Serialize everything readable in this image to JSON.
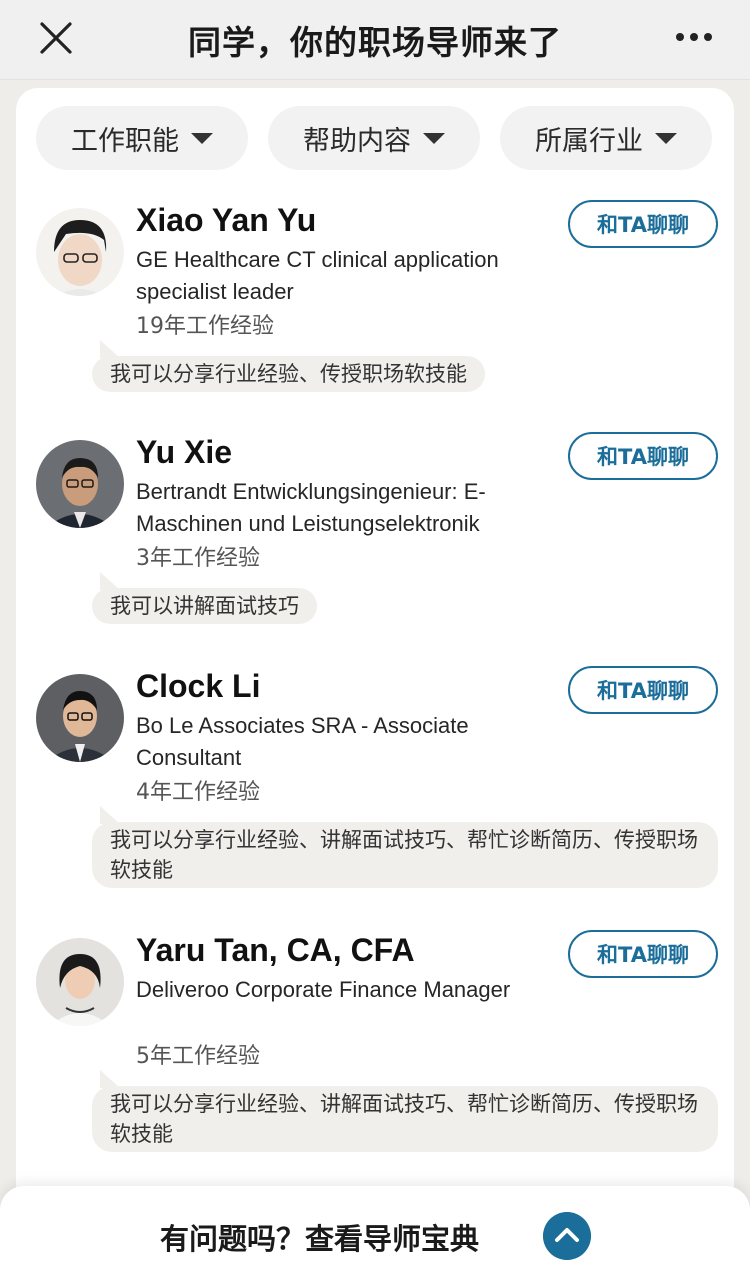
{
  "nav": {
    "title": "同学，你的职场导师来了"
  },
  "filters": [
    {
      "label": "工作职能"
    },
    {
      "label": "帮助内容"
    },
    {
      "label": "所属行业"
    }
  ],
  "chat_label": "和TA聊聊",
  "mentors": [
    {
      "name": "Xiao Yan Yu",
      "role": "GE Healthcare CT clinical application specialist leader",
      "experience": "19年工作经验",
      "help": "我可以分享行业经验、传授职场软技能"
    },
    {
      "name": "Yu Xie",
      "role": "Bertrandt Entwicklungsingenieur: E-Maschinen und Leistungselektronik",
      "experience": "3年工作经验",
      "help": "我可以讲解面试技巧"
    },
    {
      "name": "Clock Li",
      "role": "Bo Le Associates SRA - Associate Consultant",
      "experience": "4年工作经验",
      "help": "我可以分享行业经验、讲解面试技巧、帮忙诊断简历、传授职场软技能"
    },
    {
      "name": "Yaru Tan, CA, CFA",
      "role": "Deliveroo Corporate Finance Manager",
      "experience": "5年工作经验",
      "help": "我可以分享行业经验、讲解面试技巧、帮忙诊断简历、传授职场软技能"
    }
  ],
  "bottom": {
    "text": "有问题吗？查看导师宝典"
  },
  "colors": {
    "accent": "#1c6e9a",
    "bubble": "#f1efec",
    "filter_bg": "#f2f2f2"
  },
  "icons": {
    "close": "close-icon",
    "more": "more-icon",
    "expand": "chevron-up-icon"
  }
}
